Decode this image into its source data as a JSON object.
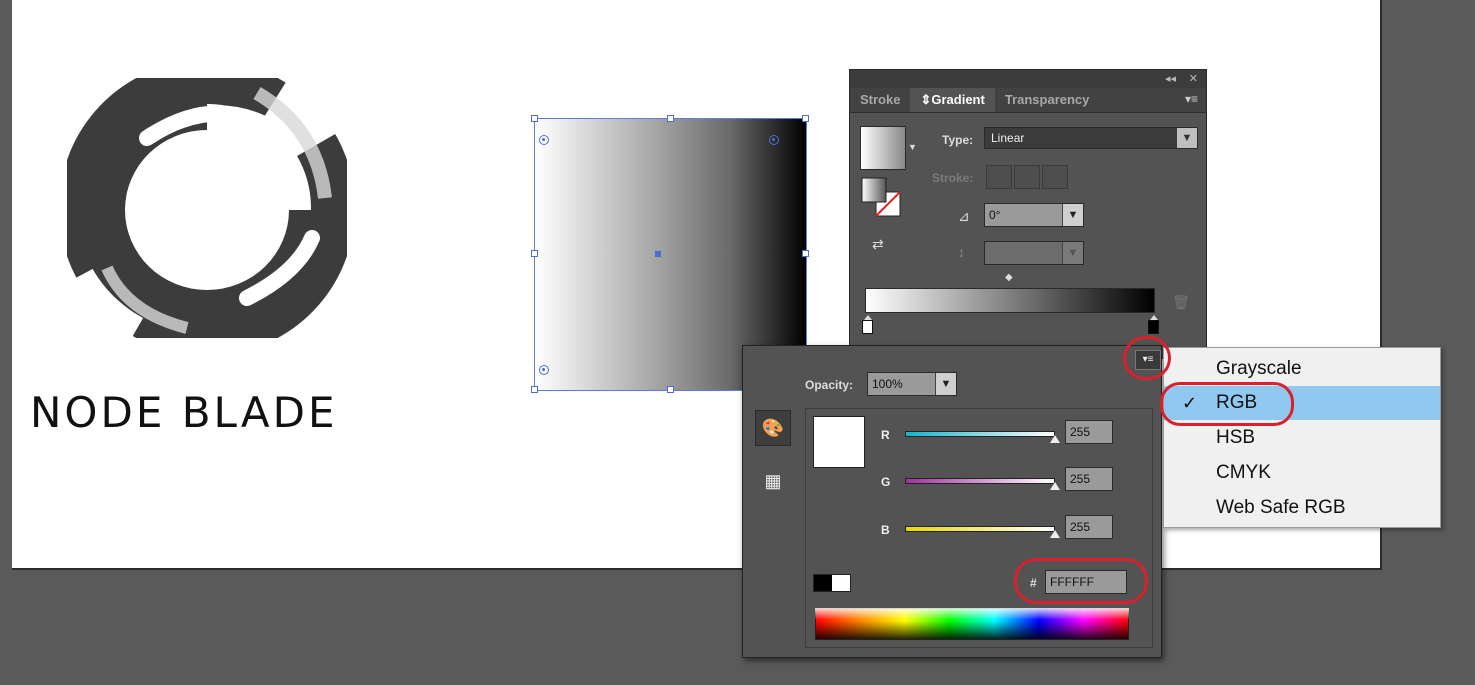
{
  "artboard": {
    "logo_text": "NODE BLADE"
  },
  "panel": {
    "tabs": [
      {
        "label": "Stroke"
      },
      {
        "label": "Gradient"
      },
      {
        "label": "Transparency"
      }
    ],
    "type_label": "Type:",
    "type_value": "Linear",
    "stroke_label": "Stroke:",
    "angle_value": "0°",
    "icons": [
      "collapse-icon",
      "close-icon",
      "panel-menu-icon",
      "angle-icon",
      "aspect-ratio-icon",
      "trash-icon",
      "reverse-gradient-icon"
    ]
  },
  "color_popup": {
    "opacity_label": "Opacity:",
    "opacity_value": "100%",
    "channels": [
      {
        "label": "R",
        "value": "255",
        "color_from": "#14b4cc",
        "color_to": "#ffffff"
      },
      {
        "label": "G",
        "value": "255",
        "color_from": "#a0329e",
        "color_to": "#ffffff"
      },
      {
        "label": "B",
        "value": "255",
        "color_from": "#e8d800",
        "color_to": "#ffffff"
      }
    ],
    "hex_label": "#",
    "hex_value": "FFFFFF",
    "current_color": "#ffffff"
  },
  "menu": {
    "items": [
      {
        "label": "Grayscale",
        "checked": false
      },
      {
        "label": "RGB",
        "checked": true
      },
      {
        "label": "HSB",
        "checked": false
      },
      {
        "label": "CMYK",
        "checked": false
      },
      {
        "label": "Web Safe RGB",
        "checked": false
      }
    ],
    "check_glyph": "✓"
  },
  "colors": {
    "annotation": "#d9202c",
    "selection": "#4a6fd0",
    "menu_highlight": "#91c8ef"
  }
}
